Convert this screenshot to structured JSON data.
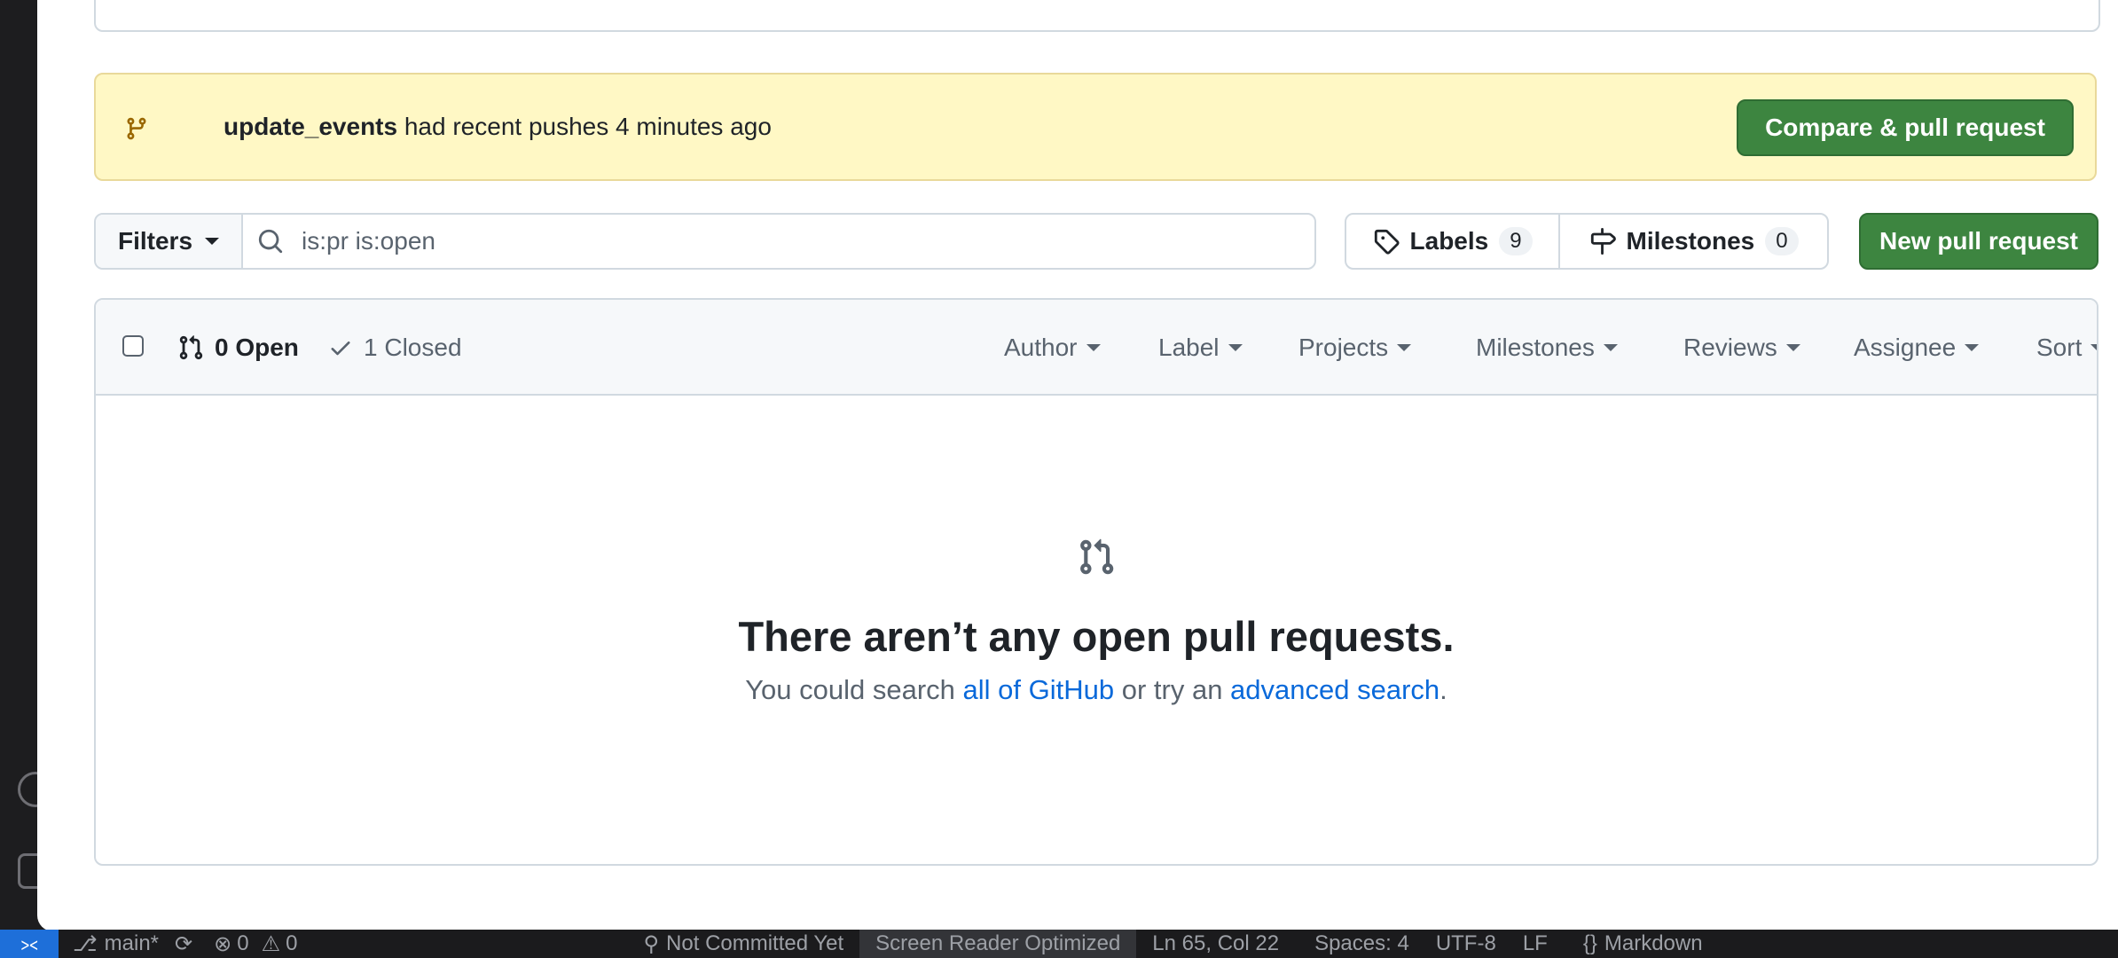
{
  "banner": {
    "branch": "update_events",
    "message": " had recent pushes 4 minutes ago",
    "compare_button": "Compare & pull request"
  },
  "toolbar": {
    "filters_label": "Filters",
    "search_value": "is:pr is:open",
    "labels_label": "Labels",
    "labels_count": "9",
    "milestones_label": "Milestones",
    "milestones_count": "0",
    "new_pr_button": "New pull request"
  },
  "list": {
    "open_label": "0 Open",
    "closed_label": "1 Closed",
    "filters": [
      "Author",
      "Label",
      "Projects",
      "Milestones",
      "Reviews",
      "Assignee",
      "Sort"
    ]
  },
  "empty": {
    "title": "There aren’t any open pull requests.",
    "text_before": "You could search ",
    "link1": "all of GitHub",
    "text_middle": " or try an ",
    "link2": "advanced search",
    "text_after": "."
  },
  "statusbar": {
    "branch": "main*",
    "errors": "0",
    "warnings": "0",
    "commit": "Not Committed Yet",
    "screen_reader": "Screen Reader Optimized",
    "position": "Ln 65, Col 22",
    "spaces": "Spaces: 4",
    "encoding": "UTF-8",
    "eol": "LF",
    "language": "Markdown"
  },
  "colors": {
    "accent_green": "#3d8540",
    "link_blue": "#0969da",
    "banner_bg": "#fff8c5"
  }
}
